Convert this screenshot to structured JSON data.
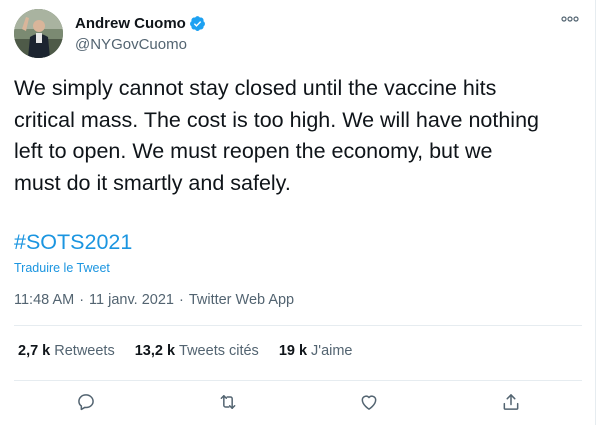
{
  "author": {
    "display_name": "Andrew Cuomo",
    "handle": "@NYGovCuomo",
    "verified_icon": "verified-badge-icon",
    "avatar_icon": "profile-photo"
  },
  "tweet": {
    "text": "We simply cannot stay closed until the vaccine hits\ncritical mass. The cost is too high. We will have nothing\nleft to open. We must reopen the economy, but we\nmust do it smartly and safely.",
    "hashtag": "#SOTS2021",
    "translate_label": "Traduire le Tweet"
  },
  "meta": {
    "time": "11:48 AM",
    "separator": "·",
    "date": "11 janv. 2021",
    "separator2": "·",
    "client": "Twitter Web App"
  },
  "stats": {
    "retweets_count": "2,7 k",
    "retweets_label": "Retweets",
    "quotes_count": "13,2 k",
    "quotes_label": "Tweets cités",
    "likes_count": "19 k",
    "likes_label": "J'aime"
  },
  "actions": [
    "reply-icon",
    "retweet-icon",
    "like-icon",
    "share-icon"
  ],
  "colors": {
    "link": "#1b95e0",
    "verified": "#1da1f2",
    "text": "#0f1419",
    "secondary": "#536471",
    "divider": "#e6ecf0"
  }
}
